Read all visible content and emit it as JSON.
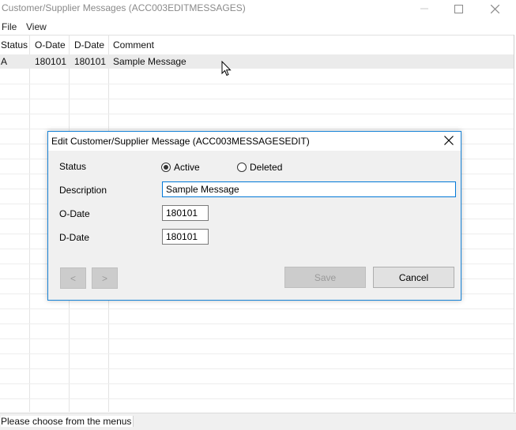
{
  "window": {
    "title": "Customer/Supplier Messages (ACC003EDITMESSAGES)"
  },
  "menu": [
    {
      "label": "File"
    },
    {
      "label": "View"
    }
  ],
  "grid": {
    "columns": [
      "Status",
      "O-Date",
      "D-Date",
      "Comment"
    ],
    "rows": [
      {
        "status": "A",
        "odate": "180101",
        "ddate": "180101",
        "comment": "Sample Message"
      }
    ]
  },
  "status_bar": {
    "text": "Please choose from the menus a"
  },
  "dialog": {
    "title": "Edit Customer/Supplier Message (ACC003MESSAGESEDIT)",
    "status_label": "Status",
    "status_options": [
      {
        "label": "Active",
        "checked": true
      },
      {
        "label": "Deleted",
        "checked": false
      }
    ],
    "description_label": "Description",
    "description_value": "Sample Message",
    "odate_label": "O-Date",
    "odate_value": "180101",
    "ddate_label": "D-Date",
    "ddate_value": "180101",
    "prev_label": "<",
    "next_label": ">",
    "save_label": "Save",
    "cancel_label": "Cancel"
  },
  "colors": {
    "accent": "#0078d7",
    "selected_row": "#ebebeb",
    "dialog_bg": "#f0f0f0"
  }
}
